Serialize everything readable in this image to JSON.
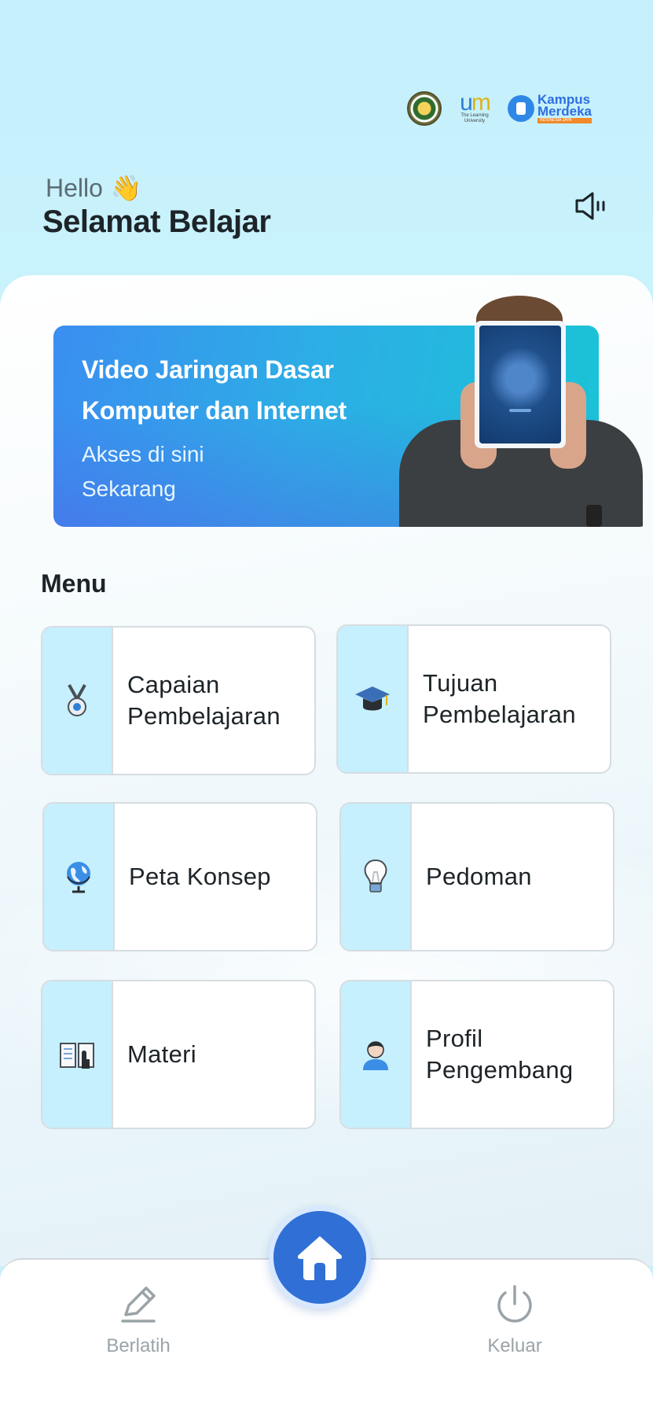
{
  "header": {
    "greeting": "Hello",
    "greeting_emoji": "👋",
    "title": "Selamat Belajar"
  },
  "logos": {
    "um_sub": "The Learning University",
    "km_line1": "Kampus",
    "km_line2": "Merdeka",
    "km_line3": "INDONESIA JAYA"
  },
  "banner": {
    "line1": "Video Jaringan Dasar",
    "line2": "Komputer dan Internet",
    "line3": "Akses di sini",
    "line4": "Sekarang"
  },
  "menu": {
    "title": "Menu",
    "items": [
      {
        "label": "Capaian\nPembelajaran",
        "icon": "medal-icon"
      },
      {
        "label": "Tujuan\nPembelajaran",
        "icon": "graduation-cap-icon"
      },
      {
        "label": "Peta Konsep",
        "icon": "globe-icon"
      },
      {
        "label": "Pedoman",
        "icon": "lightbulb-icon"
      },
      {
        "label": "Materi",
        "icon": "book-icon"
      },
      {
        "label": "Profil\nPengembang",
        "icon": "user-icon"
      }
    ]
  },
  "nav": {
    "left_label": "Berlatih",
    "right_label": "Keluar",
    "left_icon": "pencil-icon",
    "center_icon": "home-icon",
    "right_icon": "power-icon"
  },
  "colors": {
    "accent": "#2f6fd6",
    "tile_strip": "#c6f0fd",
    "header_bg": "#c5f0fc"
  }
}
